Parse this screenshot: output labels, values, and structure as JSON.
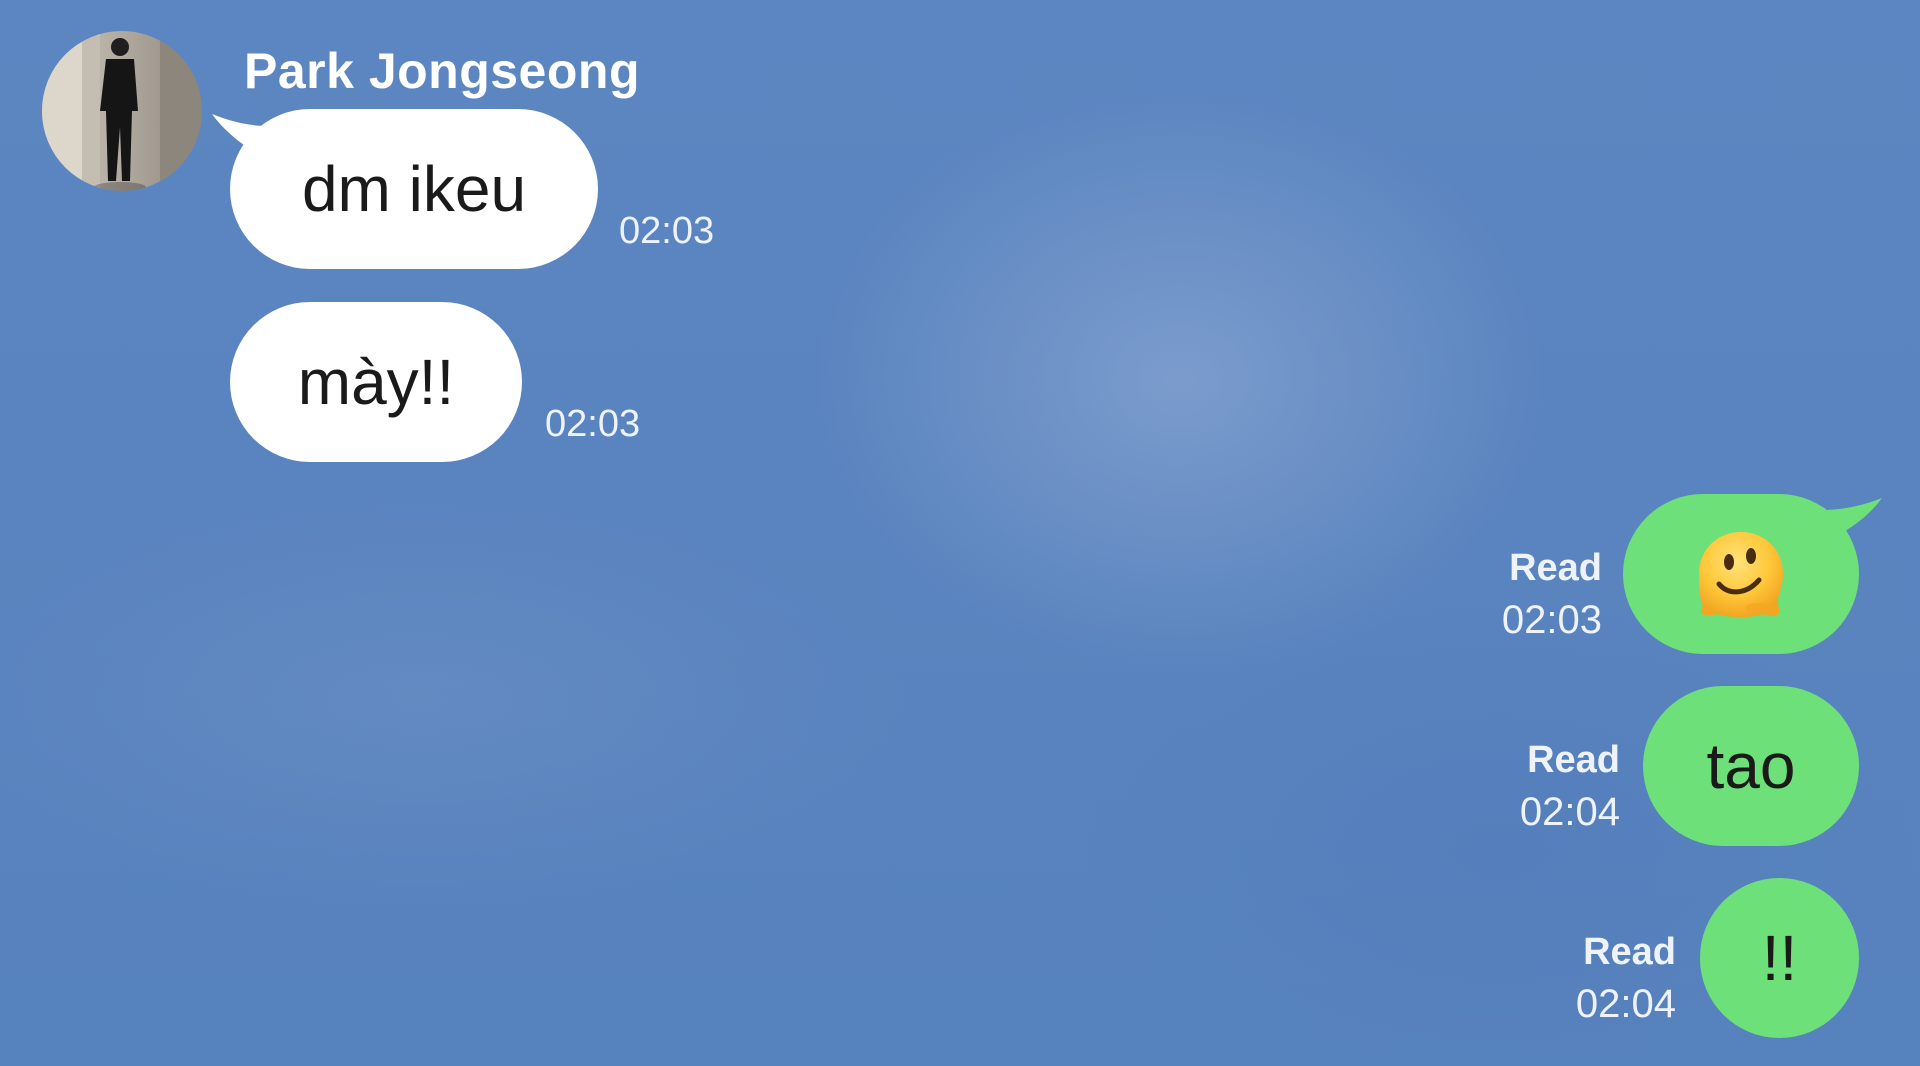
{
  "contact": {
    "name": "Park Jongseong"
  },
  "incoming": [
    {
      "text": "dm ikeu",
      "time": "02:03"
    },
    {
      "text": "mày!!",
      "time": "02:03"
    }
  ],
  "outgoing": [
    {
      "text": "",
      "icon": "melting-face-emoji",
      "status": "Read",
      "time": "02:03"
    },
    {
      "text": "tao",
      "status": "Read",
      "time": "02:04"
    },
    {
      "text": "!!",
      "status": "Read",
      "time": "02:04"
    }
  ],
  "colors": {
    "background": "#5a84bf",
    "incoming_bubble": "#ffffff",
    "outgoing_bubble": "#6ee07a",
    "meta_text": "#eef3fb"
  }
}
